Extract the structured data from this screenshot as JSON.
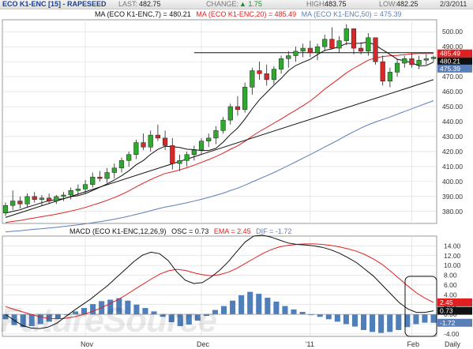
{
  "header": {
    "symbol": "ECO K1-ENC [15] - RAPESEED",
    "last_label": "LAST:",
    "last_value": "482.75",
    "change_label": "CHANGE:",
    "change_value": "▲ 1.75",
    "high_label": "HIGH:",
    "high_value": "483.75",
    "low_label": "LOW:",
    "low_value": "482.25",
    "date": "2/3/2011"
  },
  "price_legend": {
    "ma7": "MA (ECO K1-ENC,7) = 480.21",
    "ma20": "MA (ECO K1-ENC,20) = 485.49",
    "ma50": "MA (ECO K1-ENC,50) = 475.39"
  },
  "macd_legend": {
    "macd": "MACD (ECO K1-ENC,12,26,9)",
    "osc": "OSC = 0.73",
    "ema": "EMA = 2.45",
    "dif": "DIF = -1.72"
  },
  "watermark": "FutureSource",
  "colors": {
    "up": "#2ea82e",
    "down": "#d62828",
    "ma7": "#111111",
    "ma20": "#e02020",
    "ma50": "#5a7fb8",
    "hist": "#4f7fba",
    "grid": "#d9d9d9"
  },
  "chart_data": [
    {
      "type": "candlestick",
      "title": "ECO K1-ENC [15] - RAPESEED",
      "ylim": [
        372,
        508
      ],
      "yticks": [
        "500.00",
        "490.00",
        "480.00",
        "470.00",
        "460.00",
        "450.00",
        "440.00",
        "430.00",
        "420.00",
        "410.00",
        "400.00",
        "390.00",
        "380.00"
      ],
      "xticks": [
        "Nov",
        "Dec",
        "'11",
        "Feb",
        "Daily"
      ],
      "candles": [
        [
          379,
          386,
          377,
          384
        ],
        [
          384,
          394,
          381,
          387
        ],
        [
          387,
          390,
          382,
          385
        ],
        [
          385,
          392,
          383,
          390
        ],
        [
          390,
          393,
          386,
          388
        ],
        [
          388,
          391,
          384,
          389
        ],
        [
          389,
          392,
          385,
          387
        ],
        [
          387,
          391,
          385,
          390
        ],
        [
          390,
          393,
          387,
          391
        ],
        [
          391,
          396,
          388,
          394
        ],
        [
          394,
          398,
          391,
          395
        ],
        [
          395,
          401,
          392,
          398
        ],
        [
          398,
          406,
          396,
          403
        ],
        [
          403,
          407,
          400,
          402
        ],
        [
          402,
          409,
          399,
          406
        ],
        [
          406,
          412,
          402,
          409
        ],
        [
          409,
          416,
          406,
          414
        ],
        [
          414,
          420,
          410,
          418
        ],
        [
          418,
          428,
          415,
          426
        ],
        [
          426,
          432,
          421,
          423
        ],
        [
          423,
          434,
          420,
          431
        ],
        [
          431,
          438,
          427,
          429
        ],
        [
          429,
          434,
          421,
          424
        ],
        [
          424,
          429,
          408,
          412
        ],
        [
          412,
          418,
          407,
          414
        ],
        [
          414,
          420,
          410,
          418
        ],
        [
          418,
          424,
          414,
          421
        ],
        [
          421,
          429,
          418,
          427
        ],
        [
          427,
          432,
          423,
          429
        ],
        [
          429,
          437,
          425,
          434
        ],
        [
          434,
          443,
          432,
          441
        ],
        [
          441,
          452,
          438,
          450
        ],
        [
          450,
          457,
          444,
          448
        ],
        [
          448,
          466,
          446,
          463
        ],
        [
          463,
          476,
          458,
          474
        ],
        [
          474,
          480,
          468,
          472
        ],
        [
          472,
          478,
          464,
          468
        ],
        [
          468,
          477,
          465,
          475
        ],
        [
          475,
          484,
          472,
          482
        ],
        [
          482,
          487,
          476,
          484
        ],
        [
          484,
          490,
          480,
          487
        ],
        [
          487,
          492,
          483,
          489
        ],
        [
          489,
          494,
          483,
          486
        ],
        [
          486,
          492,
          481,
          490
        ],
        [
          490,
          498,
          487,
          495
        ],
        [
          495,
          503,
          492,
          489
        ],
        [
          489,
          497,
          486,
          494
        ],
        [
          494,
          505,
          491,
          502
        ],
        [
          502,
          500,
          485,
          489
        ],
        [
          489,
          493,
          485,
          487
        ],
        [
          487,
          499,
          484,
          496
        ],
        [
          496,
          493,
          478,
          480
        ],
        [
          480,
          484,
          464,
          467
        ],
        [
          467,
          476,
          463,
          473
        ],
        [
          473,
          482,
          470,
          479
        ],
        [
          479,
          484,
          476,
          482
        ],
        [
          482,
          486,
          476,
          478
        ],
        [
          478,
          484,
          475,
          481
        ],
        [
          481,
          485,
          478,
          482
        ],
        [
          482,
          484,
          480,
          483
        ]
      ],
      "series": [
        {
          "name": "MA (ECO K1-ENC,7)",
          "last": 480.21
        },
        {
          "name": "MA (ECO K1-ENC,20)",
          "last": 485.49
        },
        {
          "name": "MA (ECO K1-ENC,50)",
          "last": 475.39
        }
      ],
      "value_tags": [
        "485.49",
        "480.21",
        "475.39"
      ]
    },
    {
      "type": "line",
      "title": "MACD (ECO K1-ENC,12,26,9)",
      "ylim": [
        -4.5,
        16
      ],
      "yticks": [
        "14.00",
        "12.00",
        "10.00",
        "8.00",
        "6.00",
        "4.00",
        "2.00",
        "0.00",
        "-2.00",
        "-4.00"
      ],
      "series": [
        {
          "name": "MACD",
          "values": [
            0.0,
            -1.2,
            -2.3,
            -2.8,
            -2.9,
            -2.6,
            -1.8,
            -0.5,
            0.8,
            2.0,
            3.2,
            4.6,
            6.0,
            7.6,
            9.2,
            10.8,
            12.1,
            12.7,
            12.4,
            11.0,
            8.7,
            7.0,
            6.3,
            6.5,
            7.6,
            9.0,
            10.7,
            12.8,
            14.8,
            16.0,
            16.2,
            15.8,
            15.2,
            14.6,
            14.3,
            14.2,
            14.0,
            13.7,
            13.2,
            12.5,
            11.6,
            10.6,
            9.2,
            7.8,
            6.0,
            4.2,
            2.4,
            1.1,
            0.4,
            0.4,
            0.73
          ]
        },
        {
          "name": "EMA",
          "values": [
            1.6,
            1.0,
            0.5,
            0.0,
            -0.5,
            -0.8,
            -0.9,
            -0.8,
            -0.5,
            -0.1,
            0.5,
            1.2,
            2.0,
            2.9,
            3.9,
            5.0,
            6.1,
            7.2,
            8.2,
            8.9,
            9.2,
            9.0,
            8.5,
            8.1,
            7.9,
            8.1,
            8.6,
            9.4,
            10.4,
            11.4,
            12.4,
            13.2,
            13.8,
            14.1,
            14.3,
            14.4,
            14.4,
            14.3,
            14.1,
            13.8,
            13.4,
            12.9,
            12.2,
            11.3,
            10.2,
            8.8,
            7.3,
            5.8,
            4.4,
            3.3,
            2.45
          ]
        },
        {
          "name": "DIF",
          "values": [
            -1.0,
            -2.2,
            -2.6,
            -2.4,
            -2.0,
            -1.5,
            -0.9,
            0.0,
            0.6,
            1.3,
            2.1,
            2.7,
            3.0,
            3.3,
            2.8,
            2.0,
            1.3,
            0.6,
            -0.5,
            -1.6,
            -2.4,
            -2.1,
            -1.3,
            -0.3,
            0.9,
            1.7,
            2.8,
            3.9,
            4.6,
            4.2,
            3.4,
            2.6,
            1.7,
            1.0,
            0.5,
            0.0,
            -0.5,
            -1.0,
            -1.5,
            -2.0,
            -2.5,
            -3.2,
            -3.6,
            -3.8,
            -3.6,
            -3.2,
            -2.6,
            -2.0,
            -1.7,
            -1.72
          ]
        }
      ],
      "value_tags": [
        "2.45",
        "0.73",
        "-1.72"
      ]
    }
  ]
}
